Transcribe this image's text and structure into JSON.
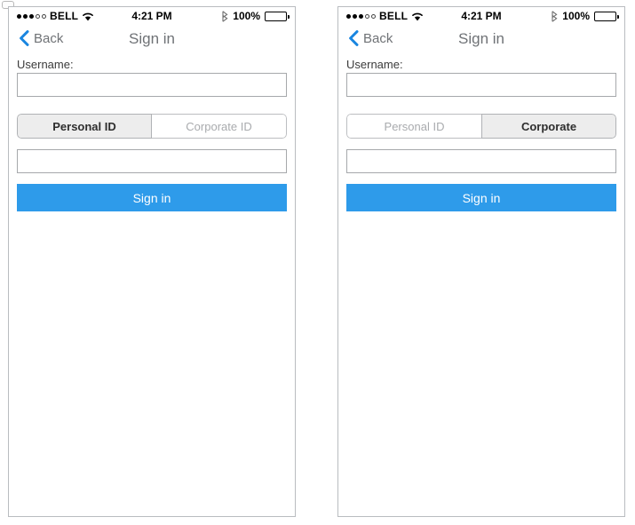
{
  "theme": {
    "accent": "#2e9bea",
    "chevron_blue": "#1a86e0",
    "nav_text": "#6f7276",
    "segment_selected_bg": "#ededed",
    "segment_unselected_text": "#a9abae",
    "frame_border": "#b9bcc0",
    "input_border": "#a6a8ab"
  },
  "status_bar": {
    "carrier": "BELL",
    "signal_dots_filled": 3,
    "signal_dots_total": 5,
    "wifi_icon": "wifi-icon",
    "time": "4:21 PM",
    "bluetooth_icon": "bluetooth-icon",
    "battery_percent": "100%",
    "battery_icon": "battery-full-icon"
  },
  "screens": [
    {
      "id": "personal-id-screen",
      "nav": {
        "back_icon": "chevron-left-icon",
        "back_label": "Back",
        "title": "Sign in"
      },
      "form": {
        "username_label": "Username:",
        "username_value": "",
        "username_placeholder": "",
        "segmented_control": {
          "options": [
            "Personal ID",
            "Corporate ID"
          ],
          "selected_index": 0
        },
        "secret_value": "",
        "secret_placeholder": "",
        "submit_label": "Sign in"
      }
    },
    {
      "id": "corporate-screen",
      "nav": {
        "back_icon": "chevron-left-icon",
        "back_label": "Back",
        "title": "Sign in"
      },
      "form": {
        "username_label": "Username:",
        "username_value": "",
        "username_placeholder": "",
        "segmented_control": {
          "options": [
            "Personal ID",
            "Corporate"
          ],
          "selected_index": 1
        },
        "secret_value": "",
        "secret_placeholder": "",
        "submit_label": "Sign in"
      }
    }
  ]
}
